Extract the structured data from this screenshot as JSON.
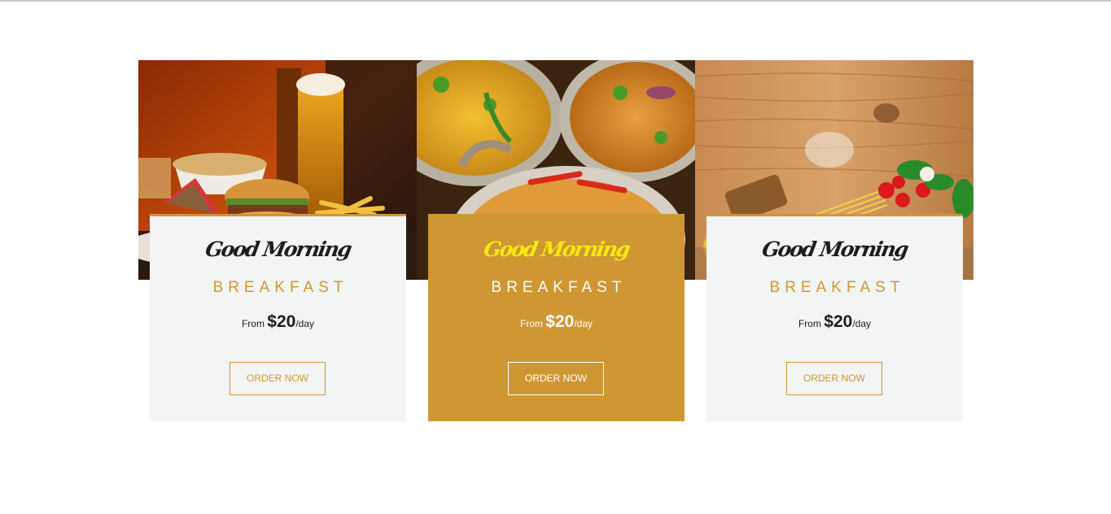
{
  "cards": [
    {
      "greeting": "Good Morning",
      "title": "BREAKFAST",
      "price_prefix": "From",
      "price_amount": "$20",
      "price_unit": "/day",
      "button_label": "ORDER NOW",
      "image": "burger-fries-beer-photo",
      "featured": false
    },
    {
      "greeting": "Good Morning",
      "title": "BREAKFAST",
      "price_prefix": "From",
      "price_amount": "$20",
      "price_unit": "/day",
      "button_label": "ORDER NOW",
      "image": "indian-curry-bowls-photo",
      "featured": true
    },
    {
      "greeting": "Good Morning",
      "title": "BREAKFAST",
      "price_prefix": "From",
      "price_amount": "$20",
      "price_unit": "/day",
      "button_label": "ORDER NOW",
      "image": "pasta-ingredients-wood-photo",
      "featured": false
    }
  ],
  "colors": {
    "accent": "#cf9733",
    "panel_bg": "#f3f4f4",
    "greeting_featured": "#f5ea10",
    "text_dark": "#1d1d1d"
  }
}
